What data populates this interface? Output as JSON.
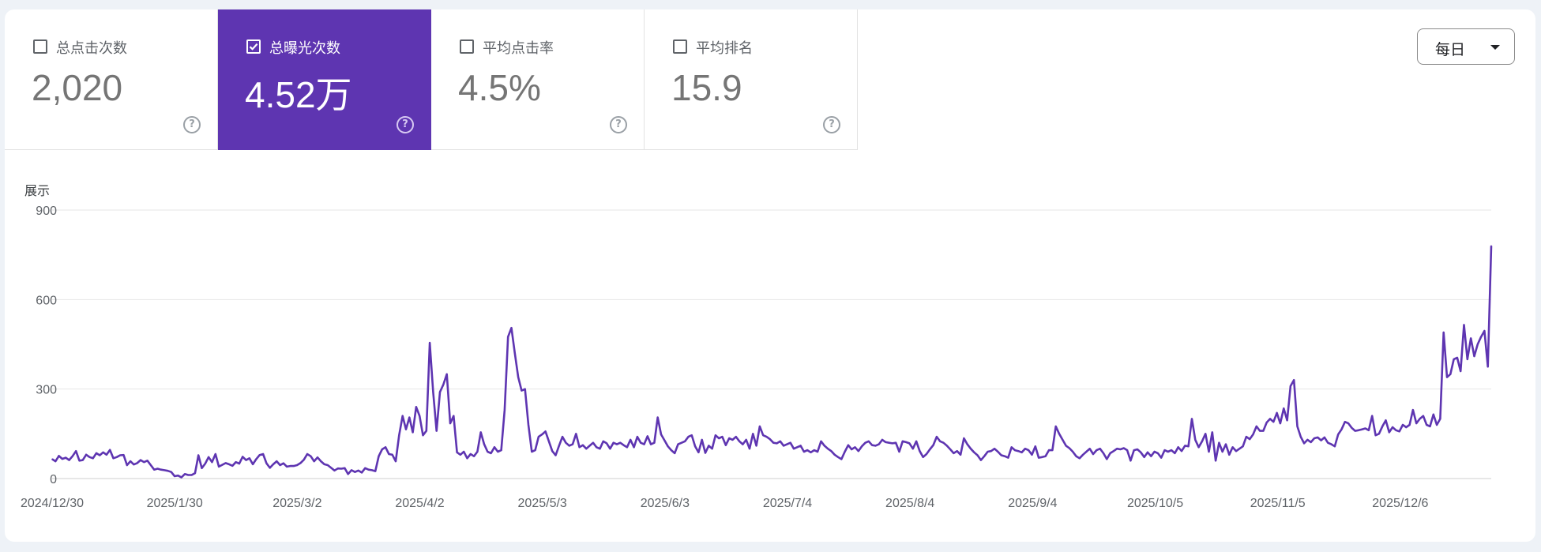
{
  "metrics": [
    {
      "label": "总点击次数",
      "value": "2,020",
      "checked": false
    },
    {
      "label": "总曝光次数",
      "value": "4.52万",
      "checked": true
    },
    {
      "label": "平均点击率",
      "value": "4.5%",
      "checked": false
    },
    {
      "label": "平均排名",
      "value": "15.9",
      "checked": false
    }
  ],
  "help_glyph": "?",
  "period_dropdown": {
    "label": "每日"
  },
  "colors": {
    "accent": "#5e35b1",
    "line": "#5e35b1",
    "grid": "#e6e6e6"
  },
  "chart_data": {
    "type": "line",
    "ylabel": "展示",
    "ylim": [
      0,
      900
    ],
    "yticks": [
      0,
      300,
      600,
      900
    ],
    "grid": true,
    "x_start": "2024/12/30",
    "x_end": "2025/12/29",
    "xtick_labels": [
      "2024/12/30",
      "2025/1/30",
      "2025/3/2",
      "2025/4/2",
      "2025/5/3",
      "2025/6/3",
      "2025/7/4",
      "2025/8/4",
      "2025/9/4",
      "2025/10/5",
      "2025/11/5",
      "2025/12/6"
    ],
    "series": [
      {
        "values": [
          65,
          58,
          76,
          66,
          70,
          62,
          75,
          92,
          60,
          62,
          80,
          72,
          68,
          85,
          78,
          88,
          80,
          96,
          68,
          72,
          78,
          79,
          45,
          58,
          47,
          52,
          62,
          55,
          60,
          45,
          30,
          33,
          30,
          28,
          26,
          22,
          8,
          10,
          4,
          15,
          12,
          12,
          18,
          78,
          35,
          50,
          72,
          55,
          82,
          40,
          46,
          52,
          48,
          43,
          55,
          50,
          73,
          62,
          68,
          48,
          65,
          79,
          82,
          51,
          36,
          48,
          58,
          45,
          51,
          40,
          42,
          42,
          45,
          52,
          63,
          82,
          75,
          58,
          71,
          58,
          48,
          45,
          36,
          27,
          34,
          33,
          35,
          15,
          28,
          22,
          27,
          20,
          35,
          30,
          28,
          25,
          75,
          98,
          105,
          82,
          80,
          58,
          145,
          210,
          165,
          205,
          155,
          240,
          210,
          145,
          160,
          455,
          290,
          160,
          290,
          315,
          350,
          185,
          210,
          88,
          80,
          90,
          68,
          82,
          75,
          90,
          155,
          115,
          90,
          85,
          105,
          90,
          95,
          230,
          475,
          505,
          420,
          340,
          295,
          300,
          180,
          90,
          95,
          140,
          148,
          158,
          125,
          92,
          78,
          110,
          140,
          120,
          110,
          115,
          150,
          105,
          112,
          100,
          110,
          120,
          105,
          100,
          125,
          118,
          100,
          120,
          115,
          120,
          112,
          105,
          130,
          105,
          140,
          120,
          115,
          142,
          115,
          120,
          205,
          148,
          128,
          108,
          95,
          85,
          115,
          120,
          125,
          140,
          145,
          108,
          88,
          130,
          86,
          110,
          100,
          145,
          135,
          140,
          112,
          135,
          130,
          140,
          125,
          115,
          130,
          100,
          150,
          110,
          175,
          145,
          140,
          132,
          120,
          118,
          125,
          110,
          115,
          120,
          100,
          105,
          110,
          90,
          95,
          88,
          95,
          90,
          125,
          110,
          100,
          92,
          80,
          72,
          65,
          90,
          112,
          98,
          105,
          92,
          108,
          120,
          125,
          112,
          110,
          115,
          130,
          122,
          120,
          118,
          120,
          90,
          125,
          122,
          118,
          100,
          125,
          92,
          72,
          82,
          98,
          112,
          140,
          125,
          120,
          110,
          98,
          85,
          92,
          80,
          135,
          115,
          100,
          88,
          78,
          62,
          75,
          90,
          92,
          100,
          90,
          78,
          75,
          70,
          105,
          95,
          92,
          88,
          100,
          95,
          80,
          108,
          70,
          72,
          75,
          95,
          95,
          175,
          150,
          130,
          110,
          102,
          90,
          75,
          68,
          80,
          90,
          100,
          82,
          95,
          100,
          85,
          65,
          85,
          92,
          100,
          98,
          102,
          95,
          60,
          95,
          98,
          88,
          72,
          88,
          75,
          90,
          85,
          70,
          95,
          90,
          95,
          85,
          105,
          92,
          110,
          108,
          200,
          130,
          105,
          125,
          150,
          90,
          155,
          60,
          120,
          90,
          115,
          80,
          105,
          92,
          100,
          108,
          140,
          132,
          148,
          175,
          160,
          160,
          188,
          200,
          190,
          220,
          185,
          235,
          195,
          310,
          330,
          175,
          140,
          118,
          130,
          122,
          135,
          138,
          128,
          138,
          120,
          115,
          108,
          148,
          165,
          190,
          185,
          170,
          160,
          162,
          165,
          168,
          162,
          210,
          145,
          150,
          175,
          195,
          155,
          172,
          162,
          158,
          180,
          172,
          180,
          230,
          185,
          200,
          210,
          180,
          175,
          215,
          180,
          200,
          490,
          340,
          350,
          400,
          405,
          360,
          515,
          400,
          470,
          410,
          450,
          475,
          495,
          375,
          780
        ],
        "color": "#5e35b1"
      }
    ]
  }
}
